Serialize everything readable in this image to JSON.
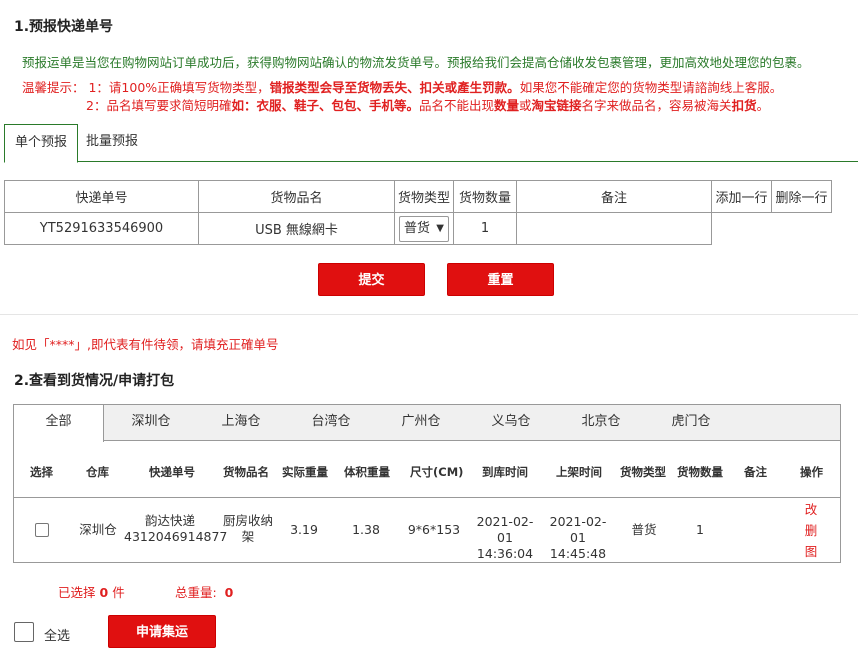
{
  "section1": {
    "title": "1.预报快递单号",
    "desc": "预报运单是当您在购物网站订单成功后，获得购物网站确认的物流发货单号。预报给我们会提高仓储收发包裹管理，更加高效地处理您的包裹。",
    "warn1": {
      "prefix": "温馨提示：  1：请100%正确填写货物类型，",
      "bold": "错报类型会导至货物丢失、扣关或產生罚款。",
      "suffix": "如果您不能確定您的货物类型请諮詢线上客服。"
    },
    "warn2": {
      "prefix": "2：品名填写要求简短明確",
      "bold1": "如：衣服、鞋子、包包、手机等。",
      "mid": "品名不能出现",
      "bold2": "数量",
      "mid2": "或",
      "bold3": "淘宝链接",
      "mid3": "名字来做品名，容易被海关",
      "bold4": "扣货",
      "end": "。"
    },
    "tabs": [
      "单个预报",
      "批量预报"
    ]
  },
  "form": {
    "headers": [
      "快递单号",
      "货物品名",
      "货物类型",
      "货物数量",
      "备注"
    ],
    "add_row": "添加一行",
    "delete_row": "删除一行",
    "tracking": "YT5291633546900",
    "product": "USB 無線網卡",
    "type": "普货",
    "quantity": "1",
    "remark": ""
  },
  "buttons": {
    "submit": "提交",
    "reset": "重置",
    "apply": "申请集运"
  },
  "note": "如见「****」,即代表有件待领，请填充正確单号",
  "section2": {
    "title": "2.查看到货情况/申请打包",
    "warehouse_tabs": [
      "全部",
      "深圳仓",
      "上海仓",
      "台湾仓",
      "广州仓",
      "义乌仓",
      "北京仓",
      "虎门仓"
    ],
    "columns": [
      "选择",
      "仓库",
      "快递单号",
      "货物品名",
      "实际重量",
      "体积重量",
      "尺寸(CM)",
      "到库时间",
      "上架时间",
      "货物类型",
      "货物数量",
      "备注",
      "操作"
    ],
    "rows": [
      {
        "warehouse": "深圳仓",
        "courier": "韵达快递",
        "tracking": "4312046914877",
        "product_l1": "厨房收纳",
        "product_l2": "架",
        "actual_weight": "3.19",
        "volume_weight": "1.38",
        "size": "9*6*153",
        "arrive_date": "2021-02-01",
        "arrive_time": "14:36:04",
        "shelf_date": "2021-02-01",
        "shelf_time": "14:45:48",
        "type": "普货",
        "quantity": "1",
        "remark": "",
        "ops": [
          "改",
          "删",
          "图"
        ]
      }
    ]
  },
  "summary": {
    "selected_label": "已选择",
    "selected_count": "0",
    "selected_unit": "件",
    "weight_label": "总重量:",
    "weight_value": "0"
  },
  "select_all": "全选",
  "colors": {
    "red": "#e01010",
    "green": "#2a7a2a"
  }
}
